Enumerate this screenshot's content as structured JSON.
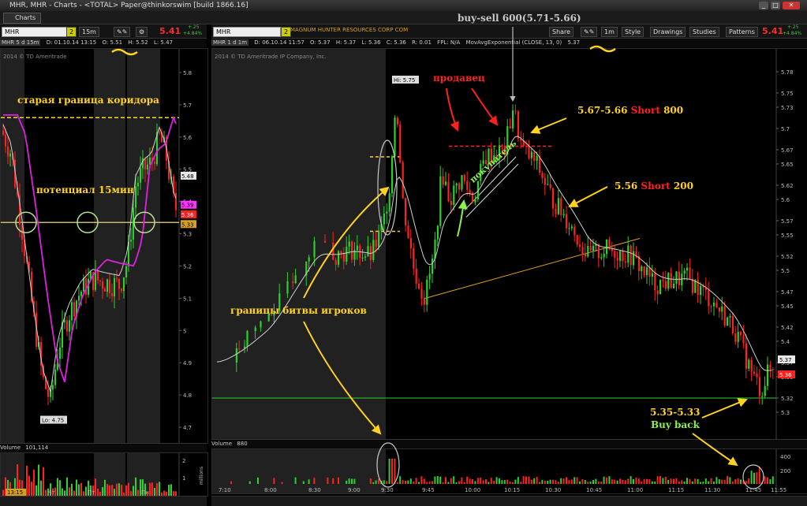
{
  "window": {
    "title": "MHR, MHR - Charts - <TOTAL> Paper@thinkorswim [build 1866.16]",
    "tab_label": "Charts"
  },
  "left_panel": {
    "symbol": "MHR",
    "link_badge": "2",
    "interval": "15m",
    "last_price": "5.41",
    "change_top": "+.25",
    "change_pct": "+4.84%",
    "study_name": "MHR 5 d 15m",
    "info": {
      "date": "D: 01.10.14 13:15",
      "open": "O: 5.51",
      "low": "L: 5.47",
      "high": "H: 5.52"
    },
    "copyright": "2014 © TD Ameritrade",
    "y_ticks": [
      "5.8",
      "5.7",
      "5.6",
      "5.5",
      "5.4",
      "5.3",
      "5.2",
      "5.1",
      "5",
      "4.9",
      "4.8",
      "4.7"
    ],
    "price_tags": [
      {
        "text": "5.48",
        "color": "#e8e8e8",
        "fg": "#000"
      },
      {
        "text": "5.39",
        "color": "#ff33ff",
        "fg": "#000"
      },
      {
        "text": "5.36",
        "color": "#ff2020",
        "fg": "#fff"
      },
      {
        "text": "5.33",
        "color": "#d4a020",
        "fg": "#000"
      }
    ],
    "hi_lo": {
      "lo": "Lo: 4.75"
    },
    "volume_label": "Volume",
    "volume_value": "101,114",
    "vol_axis_label": "millions",
    "vol_ticks": [
      "2",
      "1"
    ],
    "x_labels": [
      "13:15",
      "Чт",
      "Пт",
      "Пн"
    ],
    "annotations": {
      "corridor": "старая граница коридора",
      "potential": "потенциал 15мин"
    }
  },
  "right_panel": {
    "symbol": "MHR",
    "link_badge": "2",
    "company": "MAGNUM HUNTER RESOURCES CORP COM",
    "interval": "1m",
    "last_price": "5.41",
    "change_top": "+.25",
    "change_pct": "+4.84%",
    "buttons": {
      "share": "Share",
      "style": "Style",
      "drawings": "Drawings",
      "studies": "Studies",
      "patterns": "Patterns"
    },
    "study_name": "MHR 1 d 1m",
    "info": {
      "date": "D: 06.10.14 11:57",
      "open": "O: 5.37",
      "high": "H: 5.37",
      "low": "L: 5.36",
      "close": "C: 5.36",
      "range": "R: 0.01",
      "fpl": "FPL: N/A",
      "ma": "MovAvgExponential (CLOSE, 13, 0)",
      "ma_val": "5.37"
    },
    "copyright": "2014 © TD Ameritrade IP Company, Inc.",
    "y_ticks": [
      "5.78",
      "5.75",
      "5.73",
      "5.7",
      "5.67",
      "5.65",
      "5.62",
      "5.6",
      "5.57",
      "5.55",
      "5.52",
      "5.5",
      "5.47",
      "5.45",
      "5.42",
      "5.4",
      "5.37",
      "5.35",
      "5.32",
      "5.3"
    ],
    "price_tags": [
      {
        "text": "5.37",
        "color": "#e8e8e8",
        "fg": "#000"
      },
      {
        "text": "5.36",
        "color": "#ff2020",
        "fg": "#fff"
      }
    ],
    "hi_label": "Hi: 5.75",
    "volume_label": "Volume",
    "volume_value": "880",
    "vol_ticks": [
      "400",
      "200"
    ],
    "x_labels": [
      "7:10",
      "8:00",
      "8:30",
      "9:00",
      "9:30",
      "9:45",
      "10:00",
      "10:15",
      "10:30",
      "10:45",
      "11:00",
      "11:15",
      "11:30",
      "11:45",
      "11:55"
    ],
    "annotations": {
      "buy_sell": "buy-sell 600(5.71-5.66)",
      "seller": "продавец",
      "buyer": "покупатель",
      "short1_range": "5.67-5.66",
      "short1_word": "Short",
      "short1_qty": "800",
      "short2_price": "5.56",
      "short2_word": "Short",
      "short2_qty": "200",
      "battle": "границы битвы игроков",
      "buyback_range": "5.35-5.33",
      "buyback_text": "Buy back"
    }
  },
  "colors": {
    "up": "#2bd22b",
    "down": "#ff2020",
    "ema_white": "#d0d0d0",
    "ema_magenta": "#e020e0",
    "annotation_yellow": "#ffd21f",
    "annotation_red": "#ff2020",
    "annotation_green": "#8ef04e",
    "session_shade": "#3c3c3c"
  }
}
